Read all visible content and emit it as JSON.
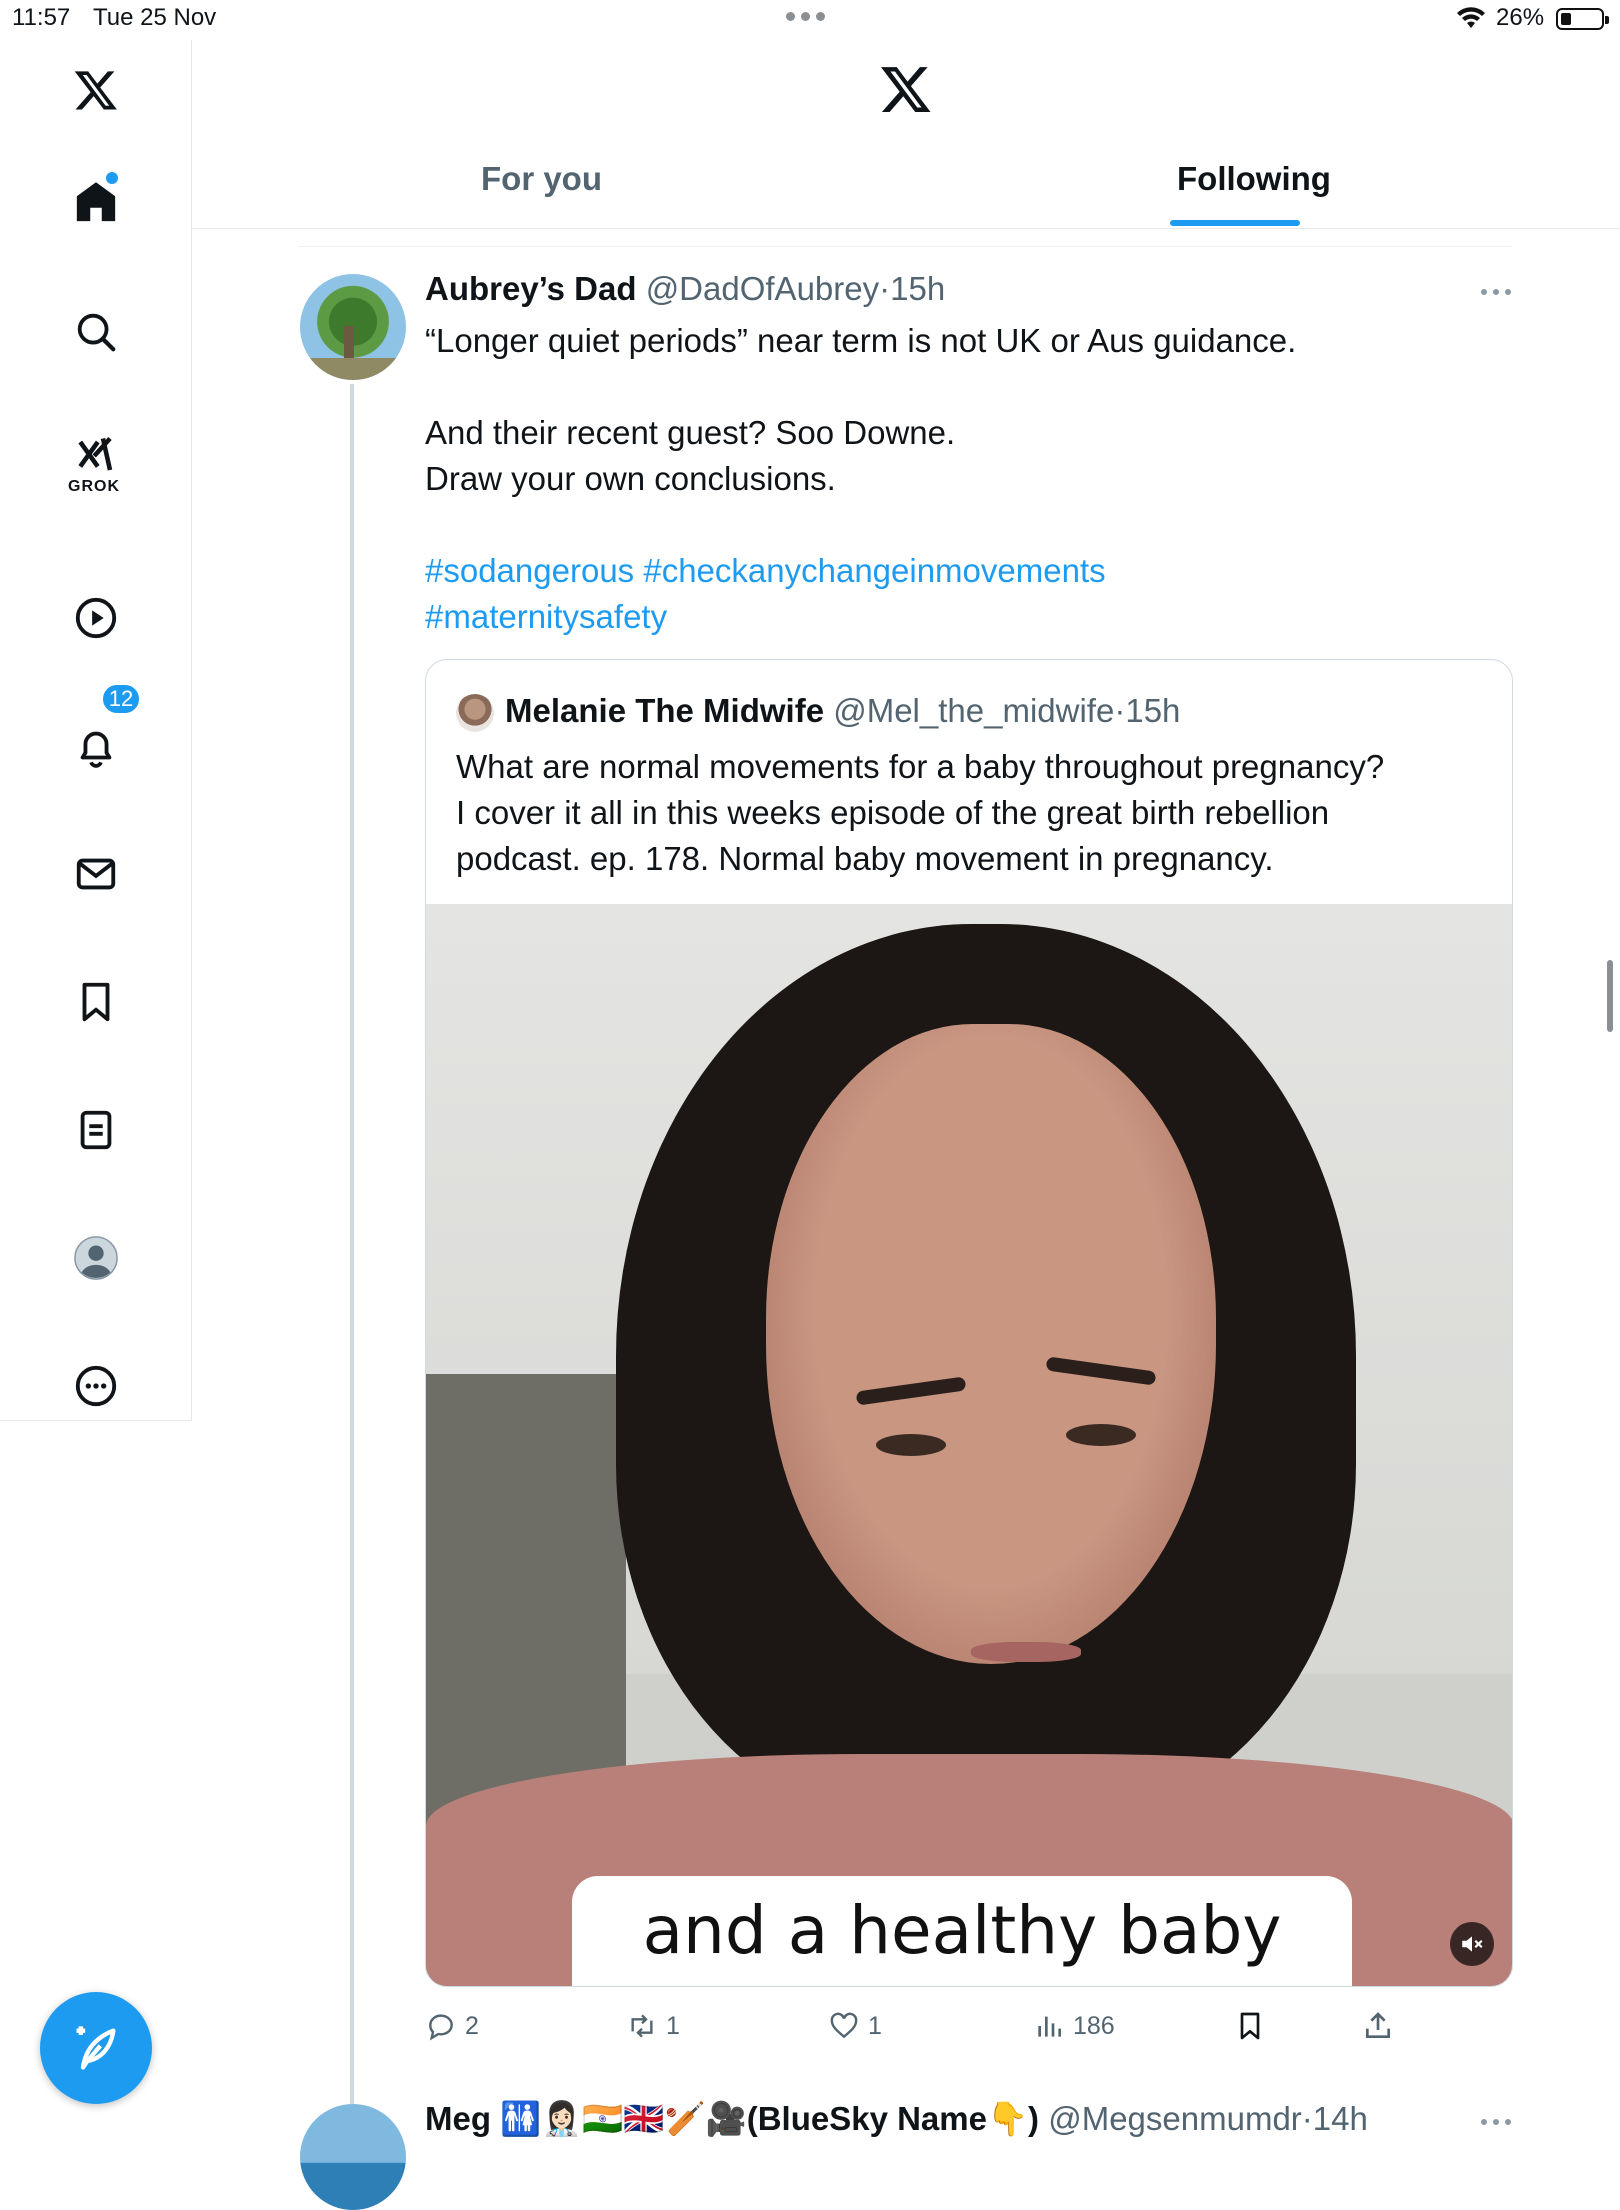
{
  "status_bar": {
    "time": "11:57",
    "date": "Tue 25 Nov",
    "battery": "26%"
  },
  "sidebar": {
    "items": [
      {
        "name": "home",
        "icon": "home-icon",
        "active": true
      },
      {
        "name": "explore",
        "icon": "search-icon"
      },
      {
        "name": "grok",
        "icon": "grok-icon",
        "label": "GROK"
      },
      {
        "name": "video",
        "icon": "play-icon"
      },
      {
        "name": "notifications",
        "icon": "bell-icon",
        "badge": "12"
      },
      {
        "name": "messages",
        "icon": "mail-icon"
      },
      {
        "name": "bookmarks",
        "icon": "bookmark-icon"
      },
      {
        "name": "lists",
        "icon": "list-icon"
      },
      {
        "name": "profile",
        "icon": "profile-icon"
      },
      {
        "name": "more",
        "icon": "more-circle-icon"
      }
    ],
    "compose_icon": "compose-icon"
  },
  "header": {
    "tabs": [
      "For you",
      "Following"
    ],
    "active_tab": "Following"
  },
  "colors": {
    "accent": "#1d9bf0",
    "text": "#0f1419",
    "secondary": "#536471"
  },
  "tweets": [
    {
      "name": "Aubrey’s Dad",
      "handle": "@DadOfAubrey",
      "separator": "·",
      "time": "15h",
      "text_lines": [
        "“Longer quiet periods” near term is not UK or Aus guidance.",
        "And their recent guest? Soo Downe.",
        "Draw your own conclusions."
      ],
      "hashtags": [
        "#sodangerous",
        "#checkanychangeinmovements",
        "#maternitysafety"
      ],
      "quote": {
        "name": "Melanie The Midwife",
        "handle": "@Mel_the_midwife",
        "time": "15h",
        "text_lines": [
          "What are normal movements for a baby throughout pregnancy?",
          "I cover it all in this weeks episode of the great birth rebellion",
          "podcast. ep. 178. Normal baby movement in pregnancy."
        ],
        "video_caption": "and a healthy baby"
      },
      "actions": {
        "replies": "2",
        "reposts": "1",
        "likes": "1",
        "views": "186"
      }
    },
    {
      "name": "Meg 🚻👩🏻‍⚕️🇮🇳🇬🇧🏏🎥(BlueSky Name👇)",
      "handle": "@Megsenmumdr",
      "time": "14h"
    }
  ]
}
